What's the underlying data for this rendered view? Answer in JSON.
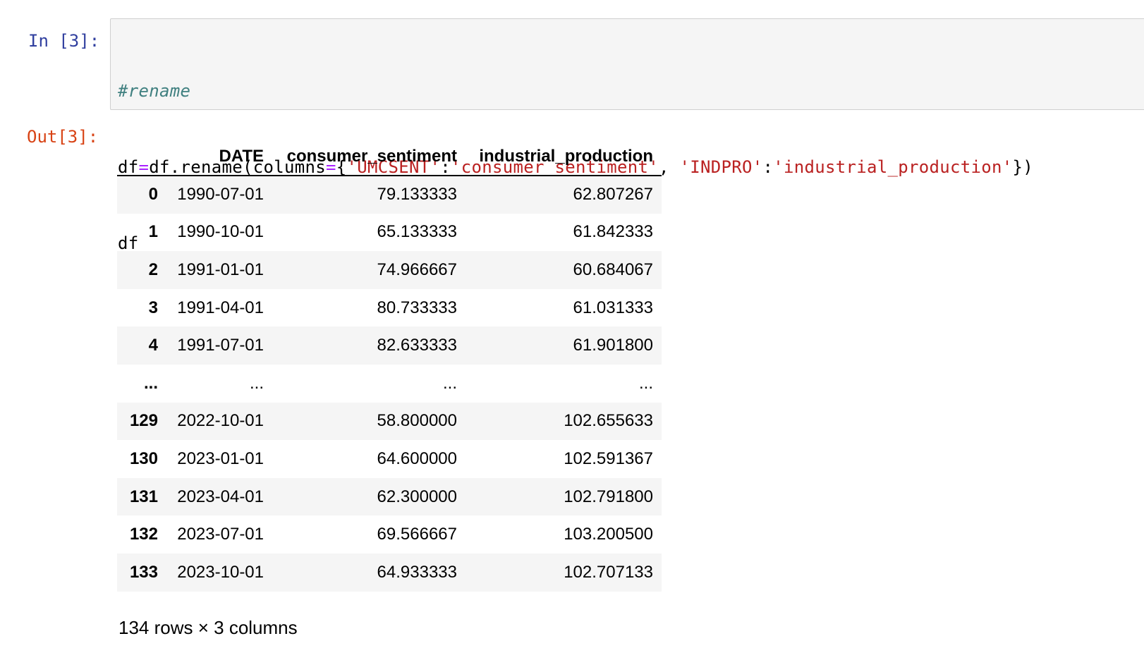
{
  "cell": {
    "in_prompt": "In [3]:",
    "out_prompt": "Out[3]:",
    "code": {
      "comment": "#rename",
      "line2": {
        "a": "df",
        "eq": "=",
        "b": "df.rename(columns",
        "eq2": "=",
        "c": "{",
        "s1": "'UMCSENT'",
        "d": ":",
        "s2": "'consumer_sentiment'",
        "e": ", ",
        "s3": "'INDPRO'",
        "f": ":",
        "s4": "'industrial_production'",
        "g": "})"
      },
      "line3": "df"
    }
  },
  "table": {
    "columns": [
      "DATE",
      "consumer_sentiment",
      "industrial_production"
    ],
    "rows": [
      {
        "index": "0",
        "date": "1990-07-01",
        "consumer_sentiment": "79.133333",
        "industrial_production": "62.807267"
      },
      {
        "index": "1",
        "date": "1990-10-01",
        "consumer_sentiment": "65.133333",
        "industrial_production": "61.842333"
      },
      {
        "index": "2",
        "date": "1991-01-01",
        "consumer_sentiment": "74.966667",
        "industrial_production": "60.684067"
      },
      {
        "index": "3",
        "date": "1991-04-01",
        "consumer_sentiment": "80.733333",
        "industrial_production": "61.031333"
      },
      {
        "index": "4",
        "date": "1991-07-01",
        "consumer_sentiment": "82.633333",
        "industrial_production": "61.901800"
      },
      {
        "index": "...",
        "date": "...",
        "consumer_sentiment": "...",
        "industrial_production": "..."
      },
      {
        "index": "129",
        "date": "2022-10-01",
        "consumer_sentiment": "58.800000",
        "industrial_production": "102.655633"
      },
      {
        "index": "130",
        "date": "2023-01-01",
        "consumer_sentiment": "64.600000",
        "industrial_production": "102.591367"
      },
      {
        "index": "131",
        "date": "2023-04-01",
        "consumer_sentiment": "62.300000",
        "industrial_production": "102.791800"
      },
      {
        "index": "132",
        "date": "2023-07-01",
        "consumer_sentiment": "69.566667",
        "industrial_production": "103.200500"
      },
      {
        "index": "133",
        "date": "2023-10-01",
        "consumer_sentiment": "64.933333",
        "industrial_production": "102.707133"
      }
    ],
    "shape": "134 rows × 3 columns"
  },
  "colors": {
    "in_prompt": "#303f9f",
    "out_prompt": "#d84315",
    "string": "#ba2121",
    "operator": "#aa22ff",
    "comment": "#408080",
    "cell_background": "#f5f5f5",
    "cell_border": "#cfcfcf"
  }
}
